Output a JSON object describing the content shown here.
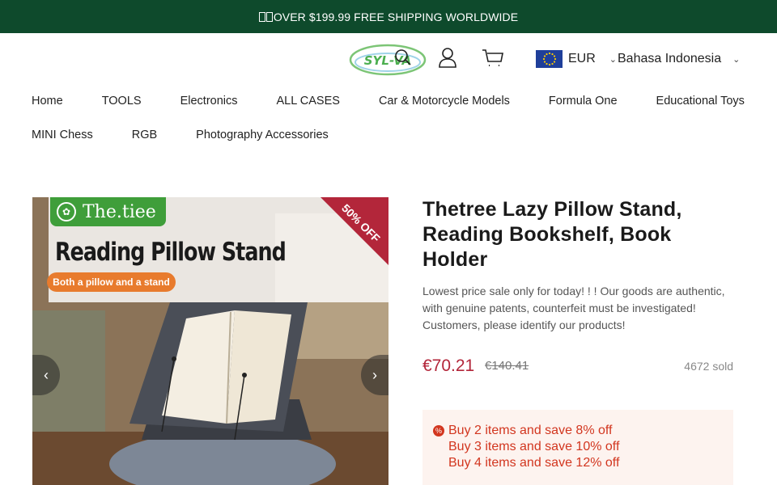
{
  "announcement": {
    "text": "OVER $199.99 FREE SHIPPING WORLDWIDE"
  },
  "header": {
    "logo_text": "SYL-VA",
    "currency": "EUR",
    "language": "Bahasa Indonesia",
    "icons": [
      "search-icon",
      "user-icon",
      "cart-icon",
      "eu-flag-icon",
      "chevron-down-icon"
    ]
  },
  "nav": {
    "row1": [
      "Home",
      "TOOLS",
      "Electronics",
      "ALL CASES",
      "Car & Motorcycle Models",
      "Formula One",
      "Educational Toys"
    ],
    "row2": [
      "MINI Chess",
      "RGB",
      "Photography Accessories"
    ]
  },
  "gallery": {
    "brand": "The.tiee",
    "title": "Reading Pillow Stand",
    "pill": "Both a pillow and a stand",
    "badge": "50% OFF"
  },
  "product": {
    "title": "Thetree Lazy Pillow Stand, Reading Bookshelf, Book Holder",
    "description": "Lowest price sale only for today! ! ! Our goods are authentic, with genuine patents, counterfeit must be investigated! Customers, please identify our products!",
    "price": "€70.21",
    "old_price": "€140.41",
    "sold": "4672 sold",
    "promotions": [
      "Buy 2 items and save 8% off",
      "Buy 3 items and save 10% off",
      "Buy 4 items and save 12% off"
    ]
  },
  "colors": {
    "announcement_bg": "#0e4a2c",
    "price": "#b3263a",
    "promo_text": "#d2361f",
    "promo_bg": "#fdf3ef",
    "brand_green": "#3f9e3a"
  }
}
